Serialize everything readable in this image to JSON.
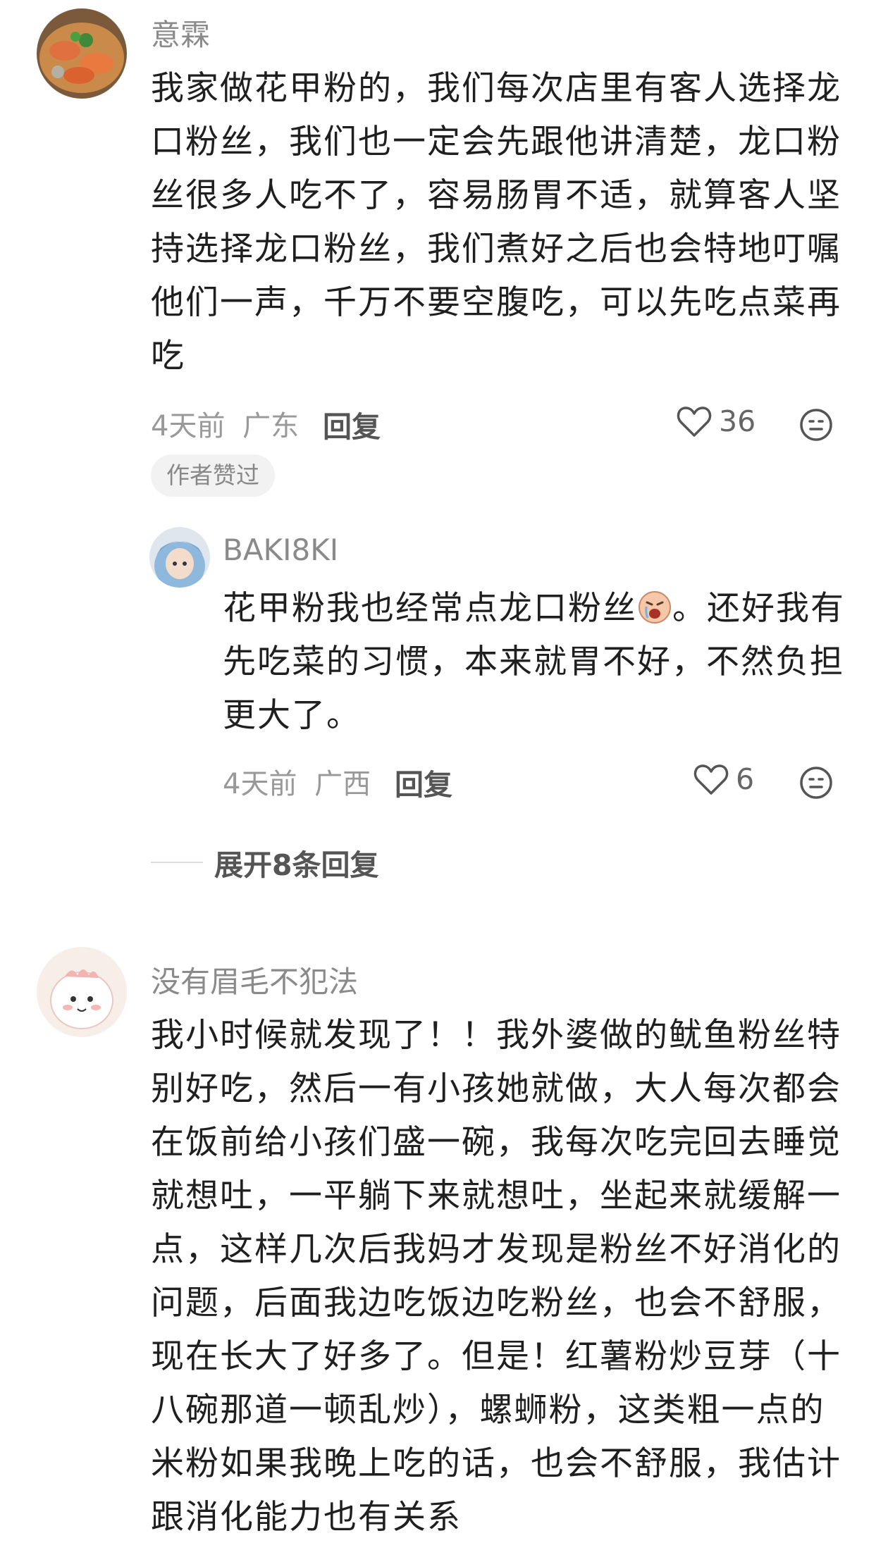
{
  "comments": [
    {
      "username": "意霖",
      "text": "我家做花甲粉的，我们每次店里有客人选择龙口粉丝，我们也一定会先跟他讲清楚，龙口粉丝很多人吃不了，容易肠胃不适，就算客人坚持选择龙口粉丝，我们煮好之后也会特地叮嘱他们一声，千万不要空腹吃，可以先吃点菜再吃",
      "time": "4天前",
      "location": "广东",
      "reply_label": "回复",
      "likes": "36",
      "badge": "作者赞过",
      "replies": [
        {
          "username": "BAKI8KI",
          "text_before_emoji": "花甲粉我也经常点龙口粉丝",
          "text_after_emoji": "。还好我有先吃菜的习惯，本来就胃不好，不然负担更大了。",
          "time": "4天前",
          "location": "广西",
          "reply_label": "回复",
          "likes": "6"
        }
      ],
      "expand_label": "展开8条回复"
    },
    {
      "username": "没有眉毛不犯法",
      "text": "我小时候就发现了！！我外婆做的鱿鱼粉丝特别好吃，然后一有小孩她就做，大人每次都会在饭前给小孩们盛一碗，我每次吃完回去睡觉就想吐，一平躺下来就想吐，坐起来就缓解一点，这样几次后我妈才发现是粉丝不好消化的问题，后面我边吃饭边吃粉丝，也会不舒服，现在长大了好多了。但是！红薯粉炒豆芽（十八碗那道一顿乱炒），螺蛳粉，这类粗一点的米粉如果我晚上吃的话，也会不舒服，我估计跟消化能力也有关系"
    }
  ],
  "icons": {
    "like": "heart-outline-icon",
    "react": "emoji-face-icon",
    "inline_emoji": "crying-face-emoji"
  },
  "colors": {
    "username": "#8a8a8a",
    "text": "#1f1f1f",
    "meta": "#999999",
    "badge_bg": "#f2f2f2"
  }
}
